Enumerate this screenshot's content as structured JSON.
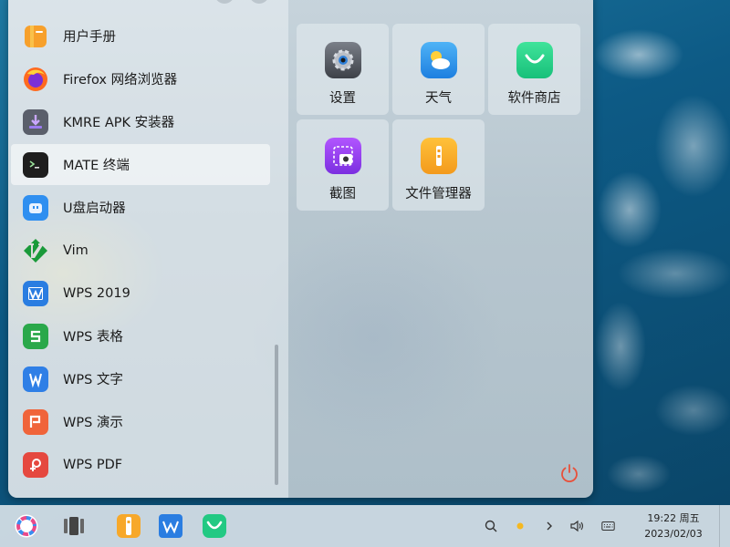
{
  "apps": [
    {
      "label": "用户手册",
      "icon": "user-manual-icon"
    },
    {
      "label": "Firefox 网络浏览器",
      "icon": "firefox-icon"
    },
    {
      "label": "KMRE APK 安装器",
      "icon": "apk-installer-icon"
    },
    {
      "label": "MATE 终端",
      "icon": "terminal-icon",
      "active": true
    },
    {
      "label": "U盘启动器",
      "icon": "usb-boot-icon"
    },
    {
      "label": "Vim",
      "icon": "vim-icon"
    },
    {
      "label": "WPS 2019",
      "icon": "wps-icon"
    },
    {
      "label": "WPS 表格",
      "icon": "wps-spreadsheet-icon"
    },
    {
      "label": "WPS 文字",
      "icon": "wps-writer-icon"
    },
    {
      "label": "WPS 演示",
      "icon": "wps-presentation-icon"
    },
    {
      "label": "WPS PDF",
      "icon": "wps-pdf-icon"
    }
  ],
  "tiles": [
    {
      "label": "设置",
      "icon": "settings-icon"
    },
    {
      "label": "天气",
      "icon": "weather-icon"
    },
    {
      "label": "软件商店",
      "icon": "software-store-icon"
    },
    {
      "label": "截图",
      "icon": "screenshot-icon"
    },
    {
      "label": "文件管理器",
      "icon": "file-manager-icon"
    }
  ],
  "taskbar": {
    "apps": [
      "start-menu-icon",
      "multitask-view-icon",
      "file-manager-icon",
      "wps-icon",
      "software-store-icon"
    ],
    "tray": [
      "search-icon",
      "night-light-icon",
      "chevron-right-icon",
      "volume-icon",
      "keyboard-icon"
    ]
  },
  "clock": {
    "time": "19:22 周五",
    "date": "2023/02/03"
  },
  "colors": {
    "accent": "#3790fa",
    "power": "#e8503a"
  }
}
